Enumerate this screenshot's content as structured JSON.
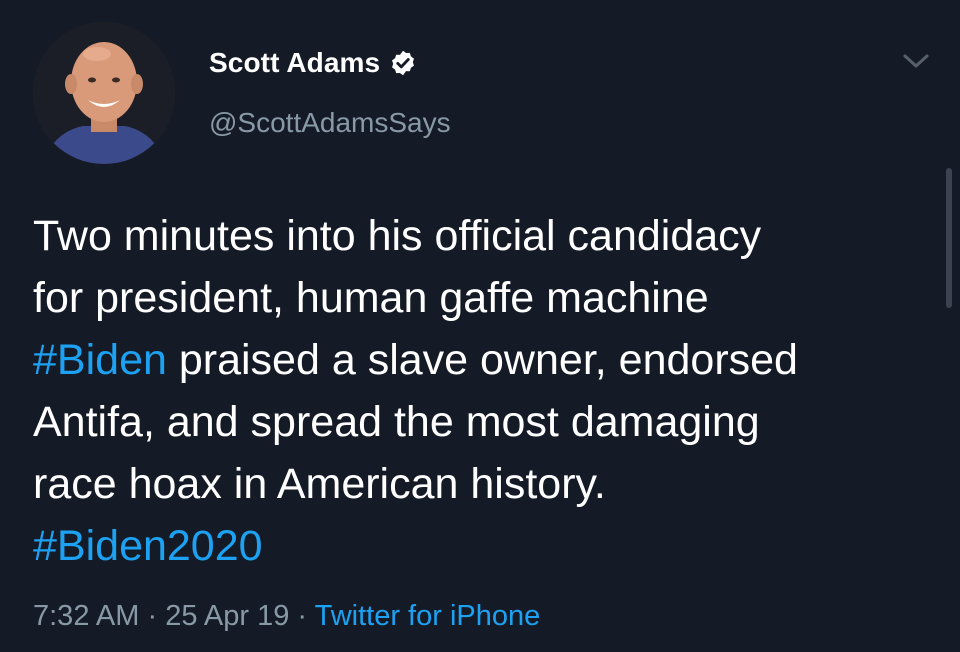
{
  "author": {
    "display_name": "Scott Adams",
    "handle": "@ScottAdamsSays",
    "verified": true
  },
  "tweet": {
    "lines": [
      [
        {
          "text": "Two minutes into his official candidacy",
          "hashtag": false
        }
      ],
      [
        {
          "text": "for president, human gaffe machine",
          "hashtag": false
        }
      ],
      [
        {
          "text": "#Biden",
          "hashtag": true
        },
        {
          "text": " praised a slave owner, endorsed",
          "hashtag": false
        }
      ],
      [
        {
          "text": "Antifa, and spread the most damaging",
          "hashtag": false
        }
      ],
      [
        {
          "text": "race hoax in American history.",
          "hashtag": false
        }
      ],
      [
        {
          "text": "#Biden2020",
          "hashtag": true
        }
      ]
    ]
  },
  "meta": {
    "time": "7:32 AM",
    "separator": " · ",
    "date": "25 Apr 19",
    "source": "Twitter for iPhone"
  },
  "icons": {
    "verified": "verified-badge-icon",
    "menu": "chevron-down-icon"
  },
  "colors": {
    "background": "#151b26",
    "link": "#1da1f2",
    "secondary_text": "#8899a6",
    "primary_text": "#ffffff"
  }
}
